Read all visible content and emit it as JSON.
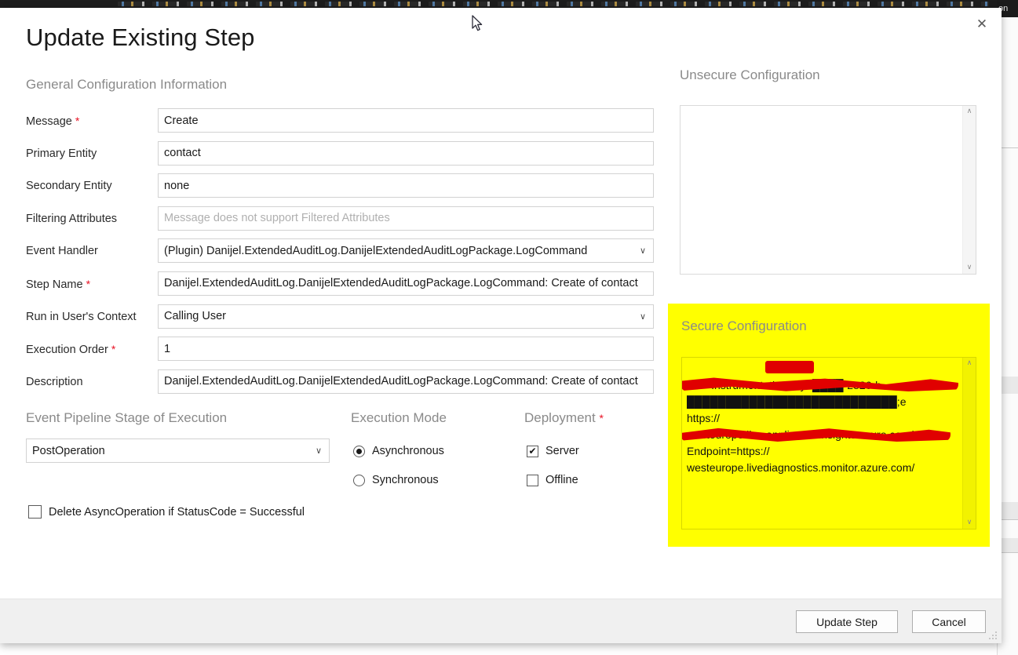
{
  "dialog": {
    "title": "Update Existing Step",
    "close_label": "✕",
    "general_section_heading": "General Configuration Information",
    "fields": [
      {
        "label": "Message",
        "required": true,
        "value": "Create",
        "placeholder": "",
        "control": "text"
      },
      {
        "label": "Primary Entity",
        "required": false,
        "value": "contact",
        "placeholder": "",
        "control": "text"
      },
      {
        "label": "Secondary Entity",
        "required": false,
        "value": "none",
        "placeholder": "",
        "control": "text"
      },
      {
        "label": "Filtering Attributes",
        "required": false,
        "value": "",
        "placeholder": "Message does not support Filtered Attributes",
        "control": "text"
      },
      {
        "label": "Event Handler",
        "required": false,
        "value": "(Plugin) Danijel.ExtendedAuditLog.DanijelExtendedAuditLogPackage.LogCommand",
        "placeholder": "",
        "control": "select"
      },
      {
        "label": "Step Name",
        "required": true,
        "value": "Danijel.ExtendedAuditLog.DanijelExtendedAuditLogPackage.LogCommand: Create of contact",
        "placeholder": "",
        "control": "text"
      },
      {
        "label": "Run in User's Context",
        "required": false,
        "value": "Calling User",
        "placeholder": "",
        "control": "select"
      },
      {
        "label": "Execution Order",
        "required": true,
        "value": "1",
        "placeholder": "",
        "control": "text"
      },
      {
        "label": "Description",
        "required": false,
        "value": "Danijel.ExtendedAuditLog.DanijelExtendedAuditLogPackage.LogCommand: Create of contact",
        "placeholder": "",
        "control": "text"
      }
    ],
    "pipeline": {
      "heading": "Event Pipeline Stage of Execution",
      "selected": "PostOperation"
    },
    "execution_mode": {
      "heading": "Execution Mode",
      "options": [
        {
          "label": "Asynchronous",
          "selected": true
        },
        {
          "label": "Synchronous",
          "selected": false
        }
      ]
    },
    "deployment": {
      "heading": "Deployment",
      "required": true,
      "options": [
        {
          "label": "Server",
          "checked": true,
          "mark": "✔"
        },
        {
          "label": "Offline",
          "checked": false,
          "mark": ""
        }
      ]
    },
    "delete_async": {
      "label": "Delete AsyncOperation if StatusCode = Successful",
      "checked": false,
      "mark": ""
    },
    "unsecure_configuration": {
      "heading": "Unsecure  Configuration",
      "value": ""
    },
    "secure_configuration": {
      "heading": "Secure  Configuration",
      "value": "InstrumentationKey=████-2826-b-\n███████████████████████████;e\nhttps://\nwesteurope.live.applicationinsights.azure.com/;Live\nEndpoint=https://\nwesteurope.livediagnostics.monitor.azure.com/",
      "panel_color": "#ffff00",
      "redaction_color": "#e00000"
    },
    "footer": {
      "primary_button": "Update Step",
      "secondary_button": "Cancel"
    },
    "scroll": {
      "up_arrow": "∧",
      "down_arrow": "∨"
    },
    "dropdown_caret": "∨"
  },
  "background": {
    "right_window_title": "on"
  }
}
